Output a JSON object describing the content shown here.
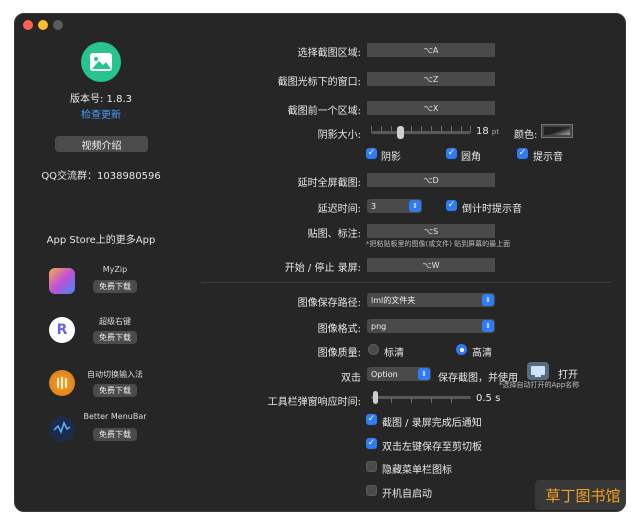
{
  "left": {
    "version": "版本号: 1.8.3",
    "check_update": "检查更新",
    "video_btn": "视频介绍",
    "qq": "QQ交流群：1038980596",
    "more_apps": "App Store上的更多App",
    "apps": [
      {
        "name": "MyZip",
        "btn": "免费下载"
      },
      {
        "name": "超级右键",
        "btn": "免费下载"
      },
      {
        "name": "自动切换输入法",
        "btn": "免费下载"
      },
      {
        "name": "Better MenuBar",
        "btn": "免费下载"
      }
    ]
  },
  "settings": {
    "sel_region": {
      "label": "选择截图区域:",
      "key": "⌥A"
    },
    "cursor_window": {
      "label": "截图光标下的窗口:",
      "key": "⌥Z"
    },
    "prev_region": {
      "label": "截图前一个区域:",
      "key": "⌥X"
    },
    "shadow": {
      "label": "阴影大小:",
      "value": "18",
      "unit": "pt",
      "level": 0.28,
      "color_label": "颜色:"
    },
    "checks1": {
      "shadow": "阴影",
      "corner": "圆角",
      "sound": "提示音"
    },
    "delayed_full": {
      "label": "延时全屏截图:",
      "key": "⌥D"
    },
    "delay": {
      "label": "延迟时间:",
      "value": "3",
      "countdown": "倒计时提示音"
    },
    "pin": {
      "label": "贴图、标注:",
      "key": "⌥S",
      "hint": "*把粘贴板里的图像(或文件) 贴到屏幕的最上面"
    },
    "record": {
      "label": "开始 / 停止 录屏:",
      "key": "⌥W"
    },
    "save_path": {
      "label": "图像保存路径:",
      "value": "lml的文件夹"
    },
    "format": {
      "label": "图像格式:",
      "value": "png"
    },
    "quality": {
      "label": "图像质量:",
      "standard": "标清",
      "high": "高清"
    },
    "double_click": {
      "label": "双击",
      "value": "Option",
      "text": "保存截图，并使用",
      "open": "打开",
      "hint": "*选择自动打开的App名称"
    },
    "toolbar": {
      "label": "工具栏弹窗响应时间:",
      "value": "0.5 s",
      "level": 0.02
    },
    "opts": [
      {
        "label": "截图 / 录屏完成后通知",
        "checked": true
      },
      {
        "label": "双击左键保存至剪切板",
        "checked": true
      },
      {
        "label": "隐藏菜单栏图标",
        "checked": false
      },
      {
        "label": "开机自启动",
        "checked": false
      }
    ]
  },
  "watermark": "草丁图书馆",
  "colors": {
    "accent": "#2f7cf6",
    "logo": "#27c48f",
    "link": "#4a9cff",
    "watermark": "#f0a020"
  }
}
